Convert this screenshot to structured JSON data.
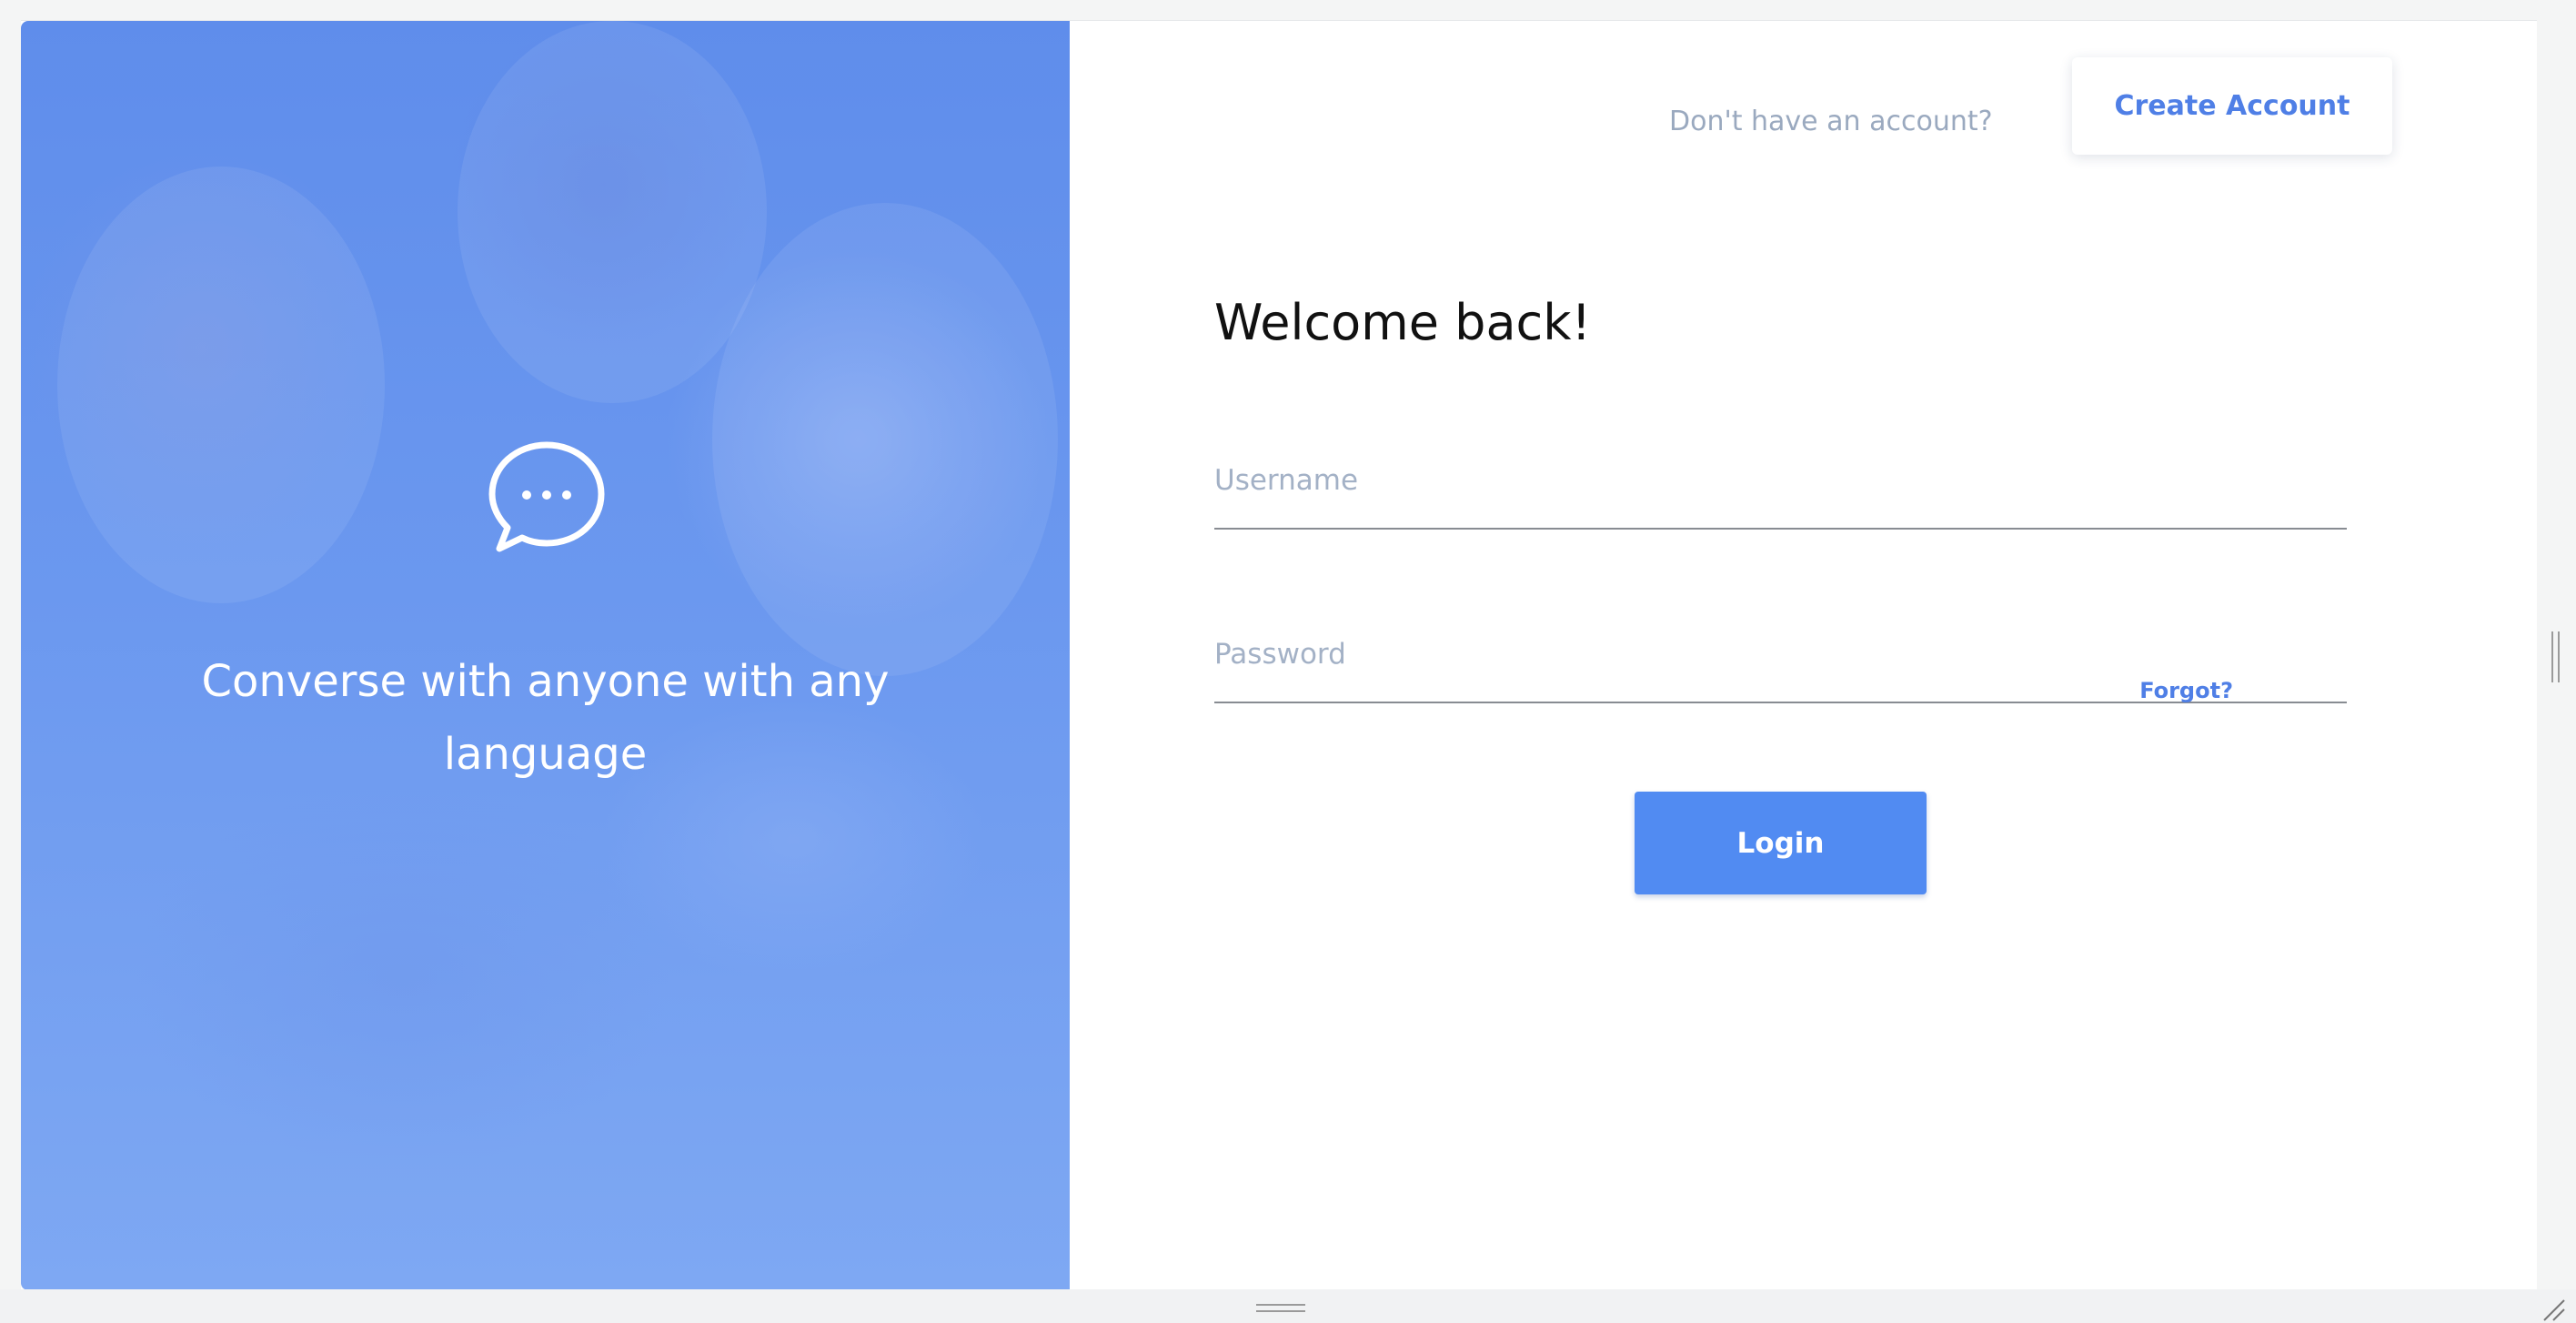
{
  "hero": {
    "icon": "chat-bubble-icon",
    "tagline": "Converse with anyone with any language"
  },
  "header": {
    "signup_prompt": "Don't have an account?",
    "create_account_label": "Create Account"
  },
  "form": {
    "title": "Welcome back!",
    "username_placeholder": "Username",
    "username_value": "",
    "password_placeholder": "Password",
    "password_value": "",
    "forgot_label": "Forgot?",
    "login_label": "Login"
  },
  "colors": {
    "accent": "#518bf2",
    "link": "#4f7fe6",
    "hero_blue": "#6b98ef",
    "muted_text": "#9aa9bf"
  }
}
